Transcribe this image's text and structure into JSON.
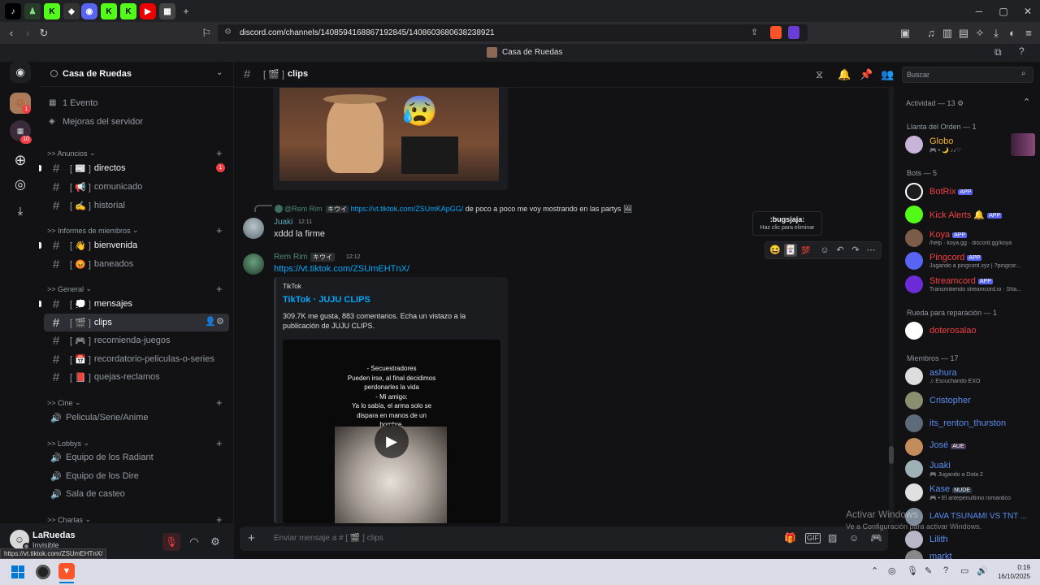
{
  "browser": {
    "url": "discord.com/channels/1408594168867192845/1408603680638238921",
    "tab_title": "Casa de Ruedas",
    "status_url": "https://vt.tiktok.com/ZSUmEHTnX/"
  },
  "server": {
    "name": "Casa de Ruedas",
    "top_items": [
      "1 Evento",
      "Mejoras del servidor"
    ],
    "badges": {
      "server1": "1",
      "server2": "10"
    }
  },
  "categories": [
    {
      "label": ">> Anuncios",
      "channels": [
        {
          "prefix": "[ 📰 ]",
          "name": "directos",
          "badge": "1"
        },
        {
          "prefix": "[ 📢 ]",
          "name": "comunicado"
        },
        {
          "prefix": "[ ✍️ ]",
          "name": "historial"
        }
      ]
    },
    {
      "label": ">> Informes de miembros",
      "channels": [
        {
          "prefix": "[ 👋 ]",
          "name": "bienvenida"
        },
        {
          "prefix": "[ 😡 ]",
          "name": "baneados"
        }
      ]
    },
    {
      "label": ">> General",
      "channels": [
        {
          "prefix": "[ 💭 ]",
          "name": "mensajes"
        },
        {
          "prefix": "[ 🎬 ]",
          "name": "clips"
        },
        {
          "prefix": "[ 🎮 ]",
          "name": "recomienda-juegos"
        },
        {
          "prefix": "[ 📅 ]",
          "name": "recordatorio-peliculas-o-series"
        },
        {
          "prefix": "[ 📕 ]",
          "name": "quejas-reclamos"
        }
      ]
    },
    {
      "label": ">> Cine",
      "channels": [
        {
          "name": "Pelicula/Serie/Anime"
        }
      ]
    },
    {
      "label": ">> Lobbys",
      "channels": [
        {
          "name": "Equipo de los Radiant"
        },
        {
          "name": "Equipo de los Dire"
        },
        {
          "name": "Sala de casteo"
        }
      ]
    },
    {
      "label": ">> Charlas",
      "channels": []
    }
  ],
  "user": {
    "name": "LaRuedas",
    "status": "Invisible"
  },
  "header": {
    "channel": "clips",
    "search_placeholder": "Buscar"
  },
  "messages": {
    "reply": {
      "author": "@Rem Rim",
      "tag": "キウイ",
      "link": "https://vt.tiktok.com/ZSUmKApGG/",
      "text": "de poco a poco me voy mostrando en las partys"
    },
    "m1": {
      "author": "Juaki",
      "time": "12:11",
      "text": "xddd la firme"
    },
    "m2": {
      "author": "Rem Rim",
      "tag": "キウイ",
      "time": "12:12",
      "link": "https://vt.tiktok.com/ZSUmEHTnX/",
      "embed_provider": "TikTok",
      "embed_title": "TikTok · JUJU CLIPS",
      "embed_desc": "309.7K me gusta, 883 comentarios. Echa un vistazo a la publicación de JUJU CLIPS.",
      "video_caption": [
        "- Secuestradores",
        "Pueden irse, al final decidimos",
        "perdonarles la vida",
        "- Mi amigo:",
        "Ya lo sabía,  el arma solo se",
        "dispara en manos de un",
        "hombre."
      ]
    }
  },
  "tooltip": {
    "title": ":bugsjaja:",
    "sub": "Haz clic para eliminar"
  },
  "composer": {
    "placeholder": "Enviar mensaje a # [ 🎬 ] clips"
  },
  "members": {
    "activity": "Actividad — 13",
    "groups": [
      {
        "label": "Llanta del Orden — 1",
        "members": [
          {
            "name": "Globo",
            "status": "🎮 • 🌙 ♪♪♡",
            "color": "#f0b232"
          }
        ]
      },
      {
        "label": "Bots — 5",
        "members": [
          {
            "name": "BotRix",
            "app": "APP",
            "color": "#f23f43"
          },
          {
            "name": "Kick Alerts 🔔",
            "app": "APP",
            "color": "#f23f43"
          },
          {
            "name": "Koya",
            "app": "APP",
            "status": "/help · koya.gg · discord.gg/koya",
            "color": "#f23f43"
          },
          {
            "name": "Pingcord",
            "app": "APP",
            "status": "Jugando a pingcord.xyz | ?pingcor...",
            "color": "#f23f43"
          },
          {
            "name": "Streamcord",
            "app": "APP",
            "status": "Transmitiendo streamcord.io · Sha...",
            "color": "#f23f43"
          }
        ]
      },
      {
        "label": "Rueda para reparación — 1",
        "members": [
          {
            "name": "doterosalao",
            "color": "#f23f43"
          }
        ]
      },
      {
        "label": "Miembros — 17",
        "members": [
          {
            "name": "ashura",
            "status": "♫ Escuchando EXO",
            "color": "#5b8def"
          },
          {
            "name": "Cristopher",
            "color": "#5b8def"
          },
          {
            "name": "its_renton_thurston",
            "color": "#5b8def"
          },
          {
            "name": "José",
            "tag": "AUE",
            "color": "#5b8def"
          },
          {
            "name": "Juaki",
            "status": "🎮 Jugando a Dota 2",
            "color": "#5b8def"
          },
          {
            "name": "Kase",
            "tag": "NUDE",
            "status": "🎮 • El antepenultimo romantico",
            "color": "#5b8def"
          },
          {
            "name": "LAVA TSUNAMI VS TNT ...",
            "color": "#5b8def"
          },
          {
            "name": "Lilith",
            "color": "#5b8def"
          },
          {
            "name": "markt",
            "color": "#5b8def"
          }
        ]
      }
    ]
  },
  "watermark": {
    "line1": "Activar Windows",
    "line2": "Ve a Configuración para activar Windows."
  },
  "clock": {
    "time": "0:19",
    "date": "16/10/2025"
  }
}
